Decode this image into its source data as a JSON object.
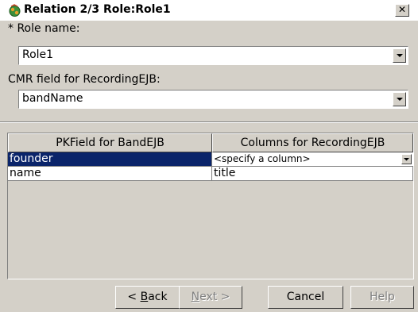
{
  "window": {
    "title": "Relation 2/3 Role:Role1",
    "close_label": "✕"
  },
  "role": {
    "label": "* Role name:",
    "value": "Role1"
  },
  "cmr": {
    "label": "CMR field for RecordingEJB:",
    "value": "bandName"
  },
  "table": {
    "columns": [
      "PKField for BandEJB",
      "Columns for RecordingEJB"
    ],
    "rows": [
      {
        "pk": "founder",
        "column": "<specify a column>",
        "selected": true
      },
      {
        "pk": "name",
        "column": "title",
        "selected": false
      }
    ]
  },
  "buttons": {
    "back_prefix": "< ",
    "back_mnemonic": "B",
    "back_suffix": "ack",
    "next_mnemonic": "N",
    "next_suffix": "ext >",
    "cancel": "Cancel",
    "help": "Help"
  },
  "colors": {
    "selection": "#0a246a",
    "dialog_bg": "#d4d0c8"
  },
  "icons": {
    "title_icon": "relation-icon",
    "dropdown": "chevron-down-icon"
  }
}
